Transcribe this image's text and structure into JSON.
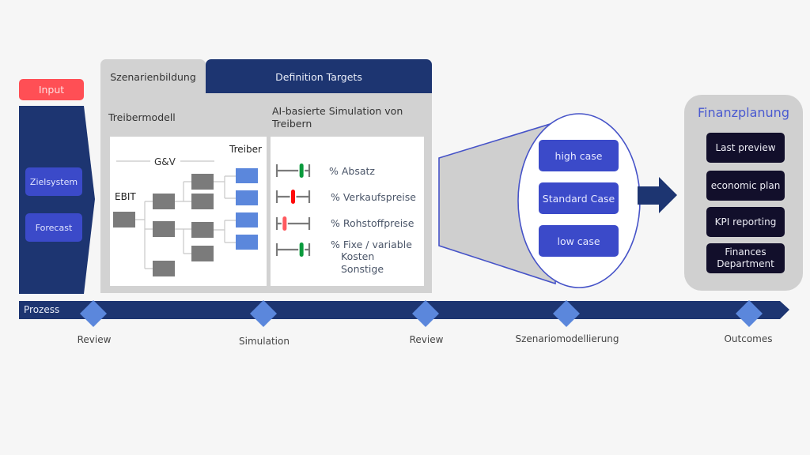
{
  "input": {
    "label": "Input",
    "items": [
      "Zielsystem",
      "Forecast"
    ]
  },
  "tabs": [
    {
      "label": "Szenarienbildung",
      "active": true
    },
    {
      "label": "Definition Targets",
      "active": false
    }
  ],
  "treibermodell": {
    "heading": "Treibermodell",
    "group_label": "G&V",
    "root_label": "EBIT",
    "leaf_label": "Treiber"
  },
  "simulation": {
    "heading": "AI-basierte Simulation von Treibern",
    "sliders": [
      {
        "label": "% Absatz",
        "value": 0.76,
        "color": "#0a9a3c"
      },
      {
        "label": "% Verkaufspreise",
        "value": 0.5,
        "color": "#ff0a0a"
      },
      {
        "label": "% Rohstoffpreise",
        "value": 0.24,
        "color": "#ff5a5f"
      },
      {
        "label": "% Fixe / variable Kosten Sonstige",
        "label_lines": [
          "% Fixe / variable",
          "Kosten",
          "Sonstige"
        ],
        "value": 0.76,
        "color": "#0a9a3c"
      }
    ]
  },
  "cases": [
    "high case",
    "Standard Case",
    "low case"
  ],
  "finanzplanung": {
    "title": "Finanzplanung",
    "items": [
      "Last preview",
      "economic plan",
      "KPI reporting",
      "Finances Department"
    ],
    "items_lines": [
      [
        "Last preview"
      ],
      [
        "economic plan"
      ],
      [
        "KPI reporting"
      ],
      [
        "Finances",
        "Department"
      ]
    ]
  },
  "process": {
    "label": "Prozess",
    "milestones": [
      "Review",
      "Simulation",
      "Review",
      "Szenariomodellierung",
      "Outcomes"
    ]
  },
  "colors": {
    "navy": "#1d3571",
    "case_blue": "#3b4ac9",
    "driver_blue": "#5b87dc",
    "input_red": "#ff4f55",
    "panel_gray": "#d2d2d2",
    "dark_item": "#120f2b"
  }
}
